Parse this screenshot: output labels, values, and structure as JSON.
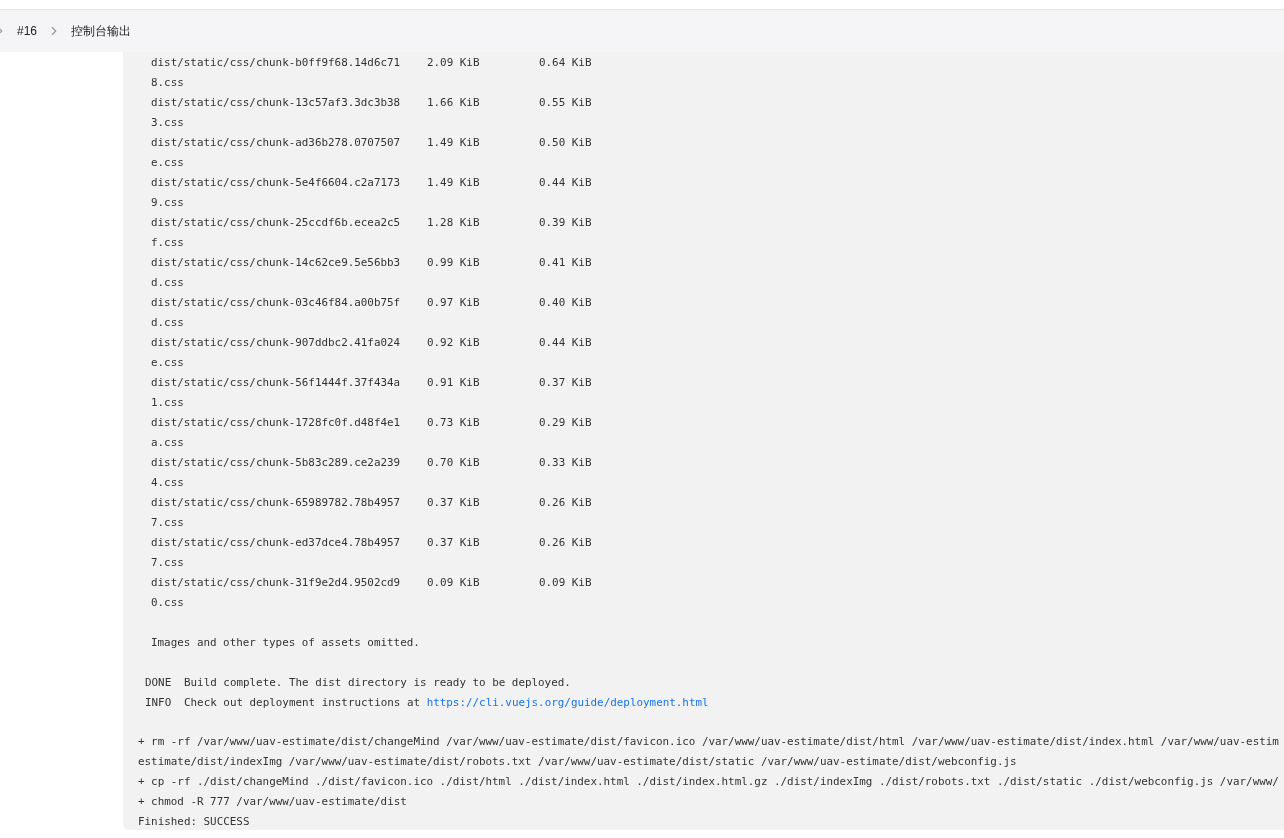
{
  "breadcrumb": [
    {
      "label": "#16"
    },
    {
      "label": "控制台输出"
    }
  ],
  "console": {
    "assets": [
      {
        "name": "dist/static/css/chunk-b0ff9f68.14d6c71",
        "name_rest": "8.css",
        "size": "2.09 KiB",
        "gzipped": "0.64 KiB"
      },
      {
        "name": "dist/static/css/chunk-13c57af3.3dc3b38",
        "name_rest": "3.css",
        "size": "1.66 KiB",
        "gzipped": "0.55 KiB"
      },
      {
        "name": "dist/static/css/chunk-ad36b278.0707507",
        "name_rest": "e.css",
        "size": "1.49 KiB",
        "gzipped": "0.50 KiB"
      },
      {
        "name": "dist/static/css/chunk-5e4f6604.c2a7173",
        "name_rest": "9.css",
        "size": "1.49 KiB",
        "gzipped": "0.44 KiB"
      },
      {
        "name": "dist/static/css/chunk-25ccdf6b.ecea2c5",
        "name_rest": "f.css",
        "size": "1.28 KiB",
        "gzipped": "0.39 KiB"
      },
      {
        "name": "dist/static/css/chunk-14c62ce9.5e56bb3",
        "name_rest": "d.css",
        "size": "0.99 KiB",
        "gzipped": "0.41 KiB"
      },
      {
        "name": "dist/static/css/chunk-03c46f84.a00b75f",
        "name_rest": "d.css",
        "size": "0.97 KiB",
        "gzipped": "0.40 KiB"
      },
      {
        "name": "dist/static/css/chunk-907ddbc2.41fa024",
        "name_rest": "e.css",
        "size": "0.92 KiB",
        "gzipped": "0.44 KiB"
      },
      {
        "name": "dist/static/css/chunk-56f1444f.37f434a",
        "name_rest": "1.css",
        "size": "0.91 KiB",
        "gzipped": "0.37 KiB"
      },
      {
        "name": "dist/static/css/chunk-1728fc0f.d48f4e1",
        "name_rest": "a.css",
        "size": "0.73 KiB",
        "gzipped": "0.29 KiB"
      },
      {
        "name": "dist/static/css/chunk-5b83c289.ce2a239",
        "name_rest": "4.css",
        "size": "0.70 KiB",
        "gzipped": "0.33 KiB"
      },
      {
        "name": "dist/static/css/chunk-65989782.78b4957",
        "name_rest": "7.css",
        "size": "0.37 KiB",
        "gzipped": "0.26 KiB"
      },
      {
        "name": "dist/static/css/chunk-ed37dce4.78b4957",
        "name_rest": "7.css",
        "size": "0.37 KiB",
        "gzipped": "0.26 KiB"
      },
      {
        "name": "dist/static/css/chunk-31f9e2d4.9502cd9",
        "name_rest": "0.css",
        "size": "0.09 KiB",
        "gzipped": "0.09 KiB"
      }
    ],
    "note": "Images and other types of assets omitted.",
    "messages": [
      {
        "tag": "DONE",
        "text": "Build complete. The dist directory is ready to be deployed."
      },
      {
        "tag": "INFO",
        "text": "Check out deployment instructions at",
        "link": "https://cli.vuejs.org/guide/deployment.html"
      }
    ],
    "commands": [
      "+ rm -rf /var/www/uav-estimate/dist/changeMind /var/www/uav-estimate/dist/favicon.ico /var/www/uav-estimate/dist/html /var/www/uav-estimate/dist/index.html /var/www/uav-estim",
      "estimate/dist/indexImg /var/www/uav-estimate/dist/robots.txt /var/www/uav-estimate/dist/static /var/www/uav-estimate/dist/webconfig.js",
      "+ cp -rf ./dist/changeMind ./dist/favicon.ico ./dist/html ./dist/index.html ./dist/index.html.gz ./dist/indexImg ./dist/robots.txt ./dist/static ./dist/webconfig.js /var/www/",
      "+ chmod -R 777 /var/www/uav-estimate/dist",
      "Finished: SUCCESS"
    ]
  }
}
